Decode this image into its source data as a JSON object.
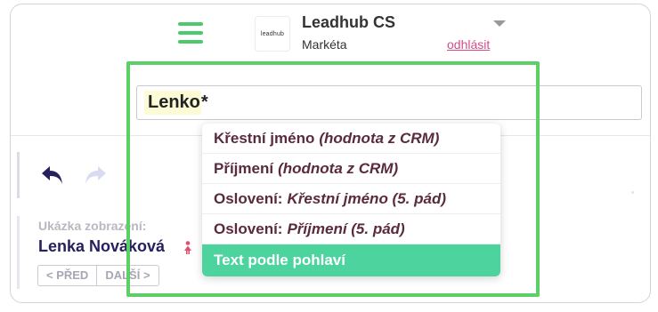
{
  "header": {
    "account_name": "Leadhub CS",
    "user_name": "Markéta",
    "logout_label": "odhlásit",
    "logo_text": "leadhub"
  },
  "search": {
    "value_highlight": "Lenko",
    "value_rest": "*"
  },
  "dropdown": {
    "items": [
      {
        "label": "Křestní jméno",
        "note": "(hodnota z CRM)"
      },
      {
        "label": "Příjmení",
        "note": "(hodnota z CRM)"
      },
      {
        "label": "Oslovení:",
        "note": "Křestní jméno (5. pád)"
      },
      {
        "label": "Oslovení:",
        "note": "Příjmení (5. pád)"
      },
      {
        "label": "Text podle pohlaví",
        "note": ""
      }
    ],
    "active_index": 4
  },
  "preview": {
    "label": "Ukázka zobrazení:",
    "name": "Lenka Nováková",
    "prev_label": "< PŘED",
    "next_label": "DALŠÍ >"
  },
  "colors": {
    "accent_green": "#5cd067",
    "active_item": "#4dd39d",
    "link_pink": "#d64c8a",
    "navy": "#26205e"
  },
  "icons": {
    "menu": "hamburger-menu-icon",
    "undo": "undo-arrow-icon",
    "redo": "redo-arrow-icon",
    "gender": "female-person-icon",
    "caret": "caret-down-icon"
  }
}
